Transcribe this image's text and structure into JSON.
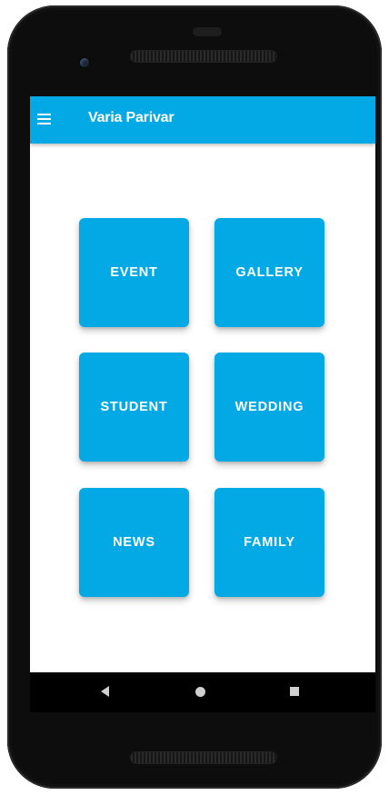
{
  "app": {
    "title": "Varia Parivar",
    "accent_color": "#03a9e4"
  },
  "appbar": {
    "menu_icon": "hamburger-menu-icon"
  },
  "tiles": [
    {
      "label": "EVENT"
    },
    {
      "label": "GALLERY"
    },
    {
      "label": "STUDENT"
    },
    {
      "label": "WEDDING"
    },
    {
      "label": "NEWS"
    },
    {
      "label": "FAMILY"
    }
  ],
  "system_nav": {
    "back_icon": "back-triangle-icon",
    "home_icon": "home-circle-icon",
    "recents_icon": "recents-square-icon"
  }
}
